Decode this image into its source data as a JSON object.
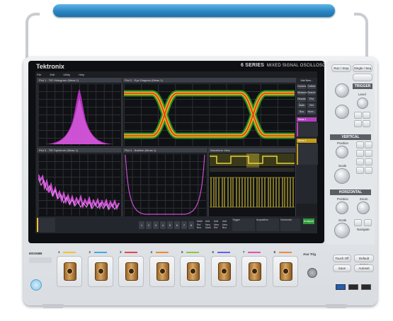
{
  "brand": "Tektronix",
  "series": {
    "bold": "6 SERIES",
    "rest": "MIXED SIGNAL OSCILLOSCOPE"
  },
  "menu": [
    "File",
    "Edit",
    "Utility",
    "Help"
  ],
  "windows": {
    "plot1": "Plot 1 - TIE Histogram (Meas 1)",
    "plot2": "Plot 2 - Eye Diagram (Meas 1)",
    "plot3": "Plot 3 - TIE Spectrum (Meas 1)",
    "plot4": "Plot 4 - Bathtub (Meas 1)",
    "waveform": "Waveform View"
  },
  "side_panel": {
    "add_new": "Add New...",
    "buttons": [
      "Cursors",
      "Callout",
      "Measure",
      "Search",
      "Results Table",
      "Plot",
      "Math",
      "Ref",
      "Bus",
      "More..."
    ],
    "meas_badge": "Meas 1",
    "meas_badge2": "Meas 2"
  },
  "bottom_bar": {
    "channels": [
      "1",
      "2",
      "3",
      "4",
      "5",
      "6",
      "7",
      "8"
    ],
    "extra": [
      "Math Ref Bus",
      "Add New Math",
      "Add New Ref",
      "Add New Bus"
    ],
    "trigger": "Trigger",
    "acq": "Acquisition",
    "horizontal": "Horizontal",
    "button": "Analyze"
  },
  "front_panel": {
    "run_stop": "Run / Stop",
    "single_seq": "Single / Seq",
    "trigger_title": "TRIGGER",
    "level": "Level",
    "vertical_title": "VERTICAL",
    "position": "Position",
    "scale": "Scale",
    "horizontal_title": "HORIZONTAL",
    "zoom": "Zoom",
    "navigate": "Navigate"
  },
  "front_bottom": {
    "model": "MSO68B",
    "channels": [
      {
        "num": "1",
        "color": "#f2c230"
      },
      {
        "num": "2",
        "color": "#40a9e6"
      },
      {
        "num": "3",
        "color": "#e2484a"
      },
      {
        "num": "4",
        "color": "#f08a2a"
      },
      {
        "num": "5",
        "color": "#8ec63f"
      },
      {
        "num": "6",
        "color": "#6a5ee8"
      },
      {
        "num": "7",
        "color": "#e84fb5"
      },
      {
        "num": "8",
        "color": "#ef8c34"
      }
    ],
    "aux_trig": "Aux Trig",
    "touch_off": "Touch Off",
    "default_setup": "Default Setup",
    "save": "Save",
    "autoset": "Autoset"
  }
}
